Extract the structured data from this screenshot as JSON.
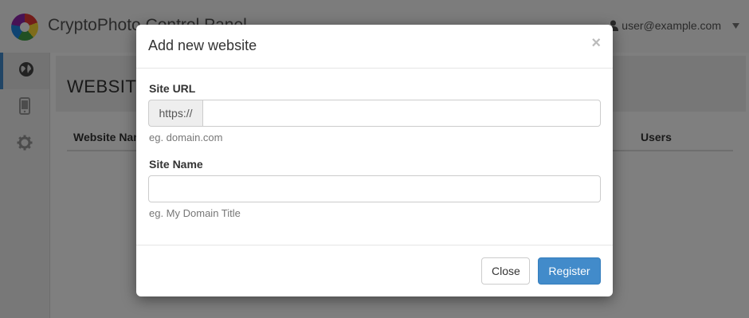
{
  "navbar": {
    "brand": "CryptoPhoto Control Panel",
    "user": "user@example.com"
  },
  "sidebar": {
    "items": [
      {
        "icon": "globe-icon",
        "active": true
      },
      {
        "icon": "mobile-icon",
        "active": false
      },
      {
        "icon": "gear-icon",
        "active": false
      }
    ]
  },
  "main": {
    "title": "WEBSITES",
    "columns": [
      "Website Name",
      "Users"
    ]
  },
  "modal": {
    "title": "Add new website",
    "close_symbol": "×",
    "site_url": {
      "label": "Site URL",
      "prefix": "https://",
      "value": "",
      "help": "eg. domain.com"
    },
    "site_name": {
      "label": "Site Name",
      "value": "",
      "help": "eg. My Domain Title"
    },
    "buttons": {
      "close": "Close",
      "register": "Register"
    }
  },
  "colors": {
    "primary": "#428bca",
    "backdrop": "rgba(0,0,0,0.5)"
  }
}
